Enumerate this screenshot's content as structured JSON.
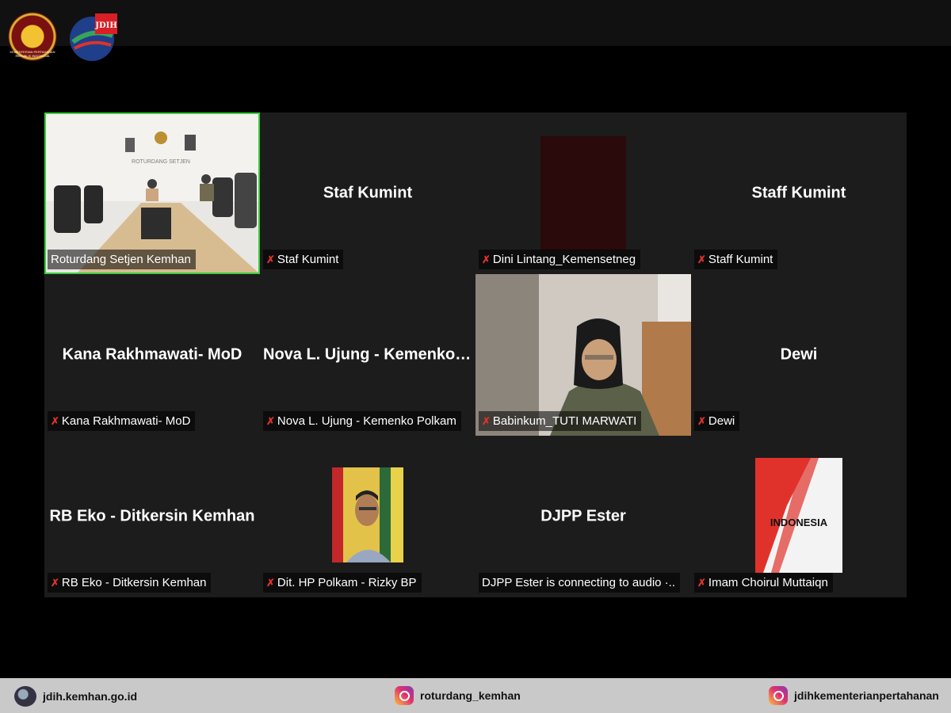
{
  "header": {
    "logo_kemhan_text": "KEMENTERIAN PERTAHANAN REPUBLIK INDONESIA",
    "logo_jdih_text": "JDIH"
  },
  "tiles": [
    {
      "label": "Roturdang Setjen Kemhan",
      "big": "",
      "video": true,
      "muted": false,
      "active": true
    },
    {
      "label": "Staf Kumint",
      "big": "Staf Kumint",
      "muted": true
    },
    {
      "label": "Dini Lintang_Kemensetneg",
      "big": "",
      "muted": true
    },
    {
      "label": "Staff Kumint",
      "big": "Staff Kumint",
      "muted": true
    },
    {
      "label": "Kana Rakhmawati- MoD",
      "big": "Kana Rakhmawati- MoD",
      "muted": true
    },
    {
      "label": "Nova L. Ujung - Kemenko Polkam",
      "big": "Nova L. Ujung - Kemenko P...",
      "muted": true
    },
    {
      "label": "Babinkum_TUTI MARWATI",
      "big": "",
      "video": true,
      "muted": true
    },
    {
      "label": "Dewi",
      "big": "Dewi",
      "muted": true
    },
    {
      "label": "RB Eko - Ditkersin Kemhan",
      "big": "RB Eko - Ditkersin Kemhan",
      "muted": true
    },
    {
      "label": "Dit. HP Polkam - Rizky BP",
      "big": "",
      "muted": true
    },
    {
      "label": "DJPP Ester is connecting to audio ·..",
      "big": "DJPP Ester",
      "muted": false
    },
    {
      "label": "Imam Choirul Muttaiqn",
      "big": "",
      "muted": true,
      "avatar_text": "INDONESIA"
    }
  ],
  "room_wall_text": "ROTURDANG SETJEN",
  "footer": {
    "website": "jdih.kemhan.go.id",
    "instagram1": "roturdang_kemhan",
    "instagram2": "jdihkementerianpertahanan"
  },
  "colors": {
    "active_border": "#3ccd3c",
    "muted_mic": "#e0322b",
    "tile_bg": "#1c1c1c"
  }
}
